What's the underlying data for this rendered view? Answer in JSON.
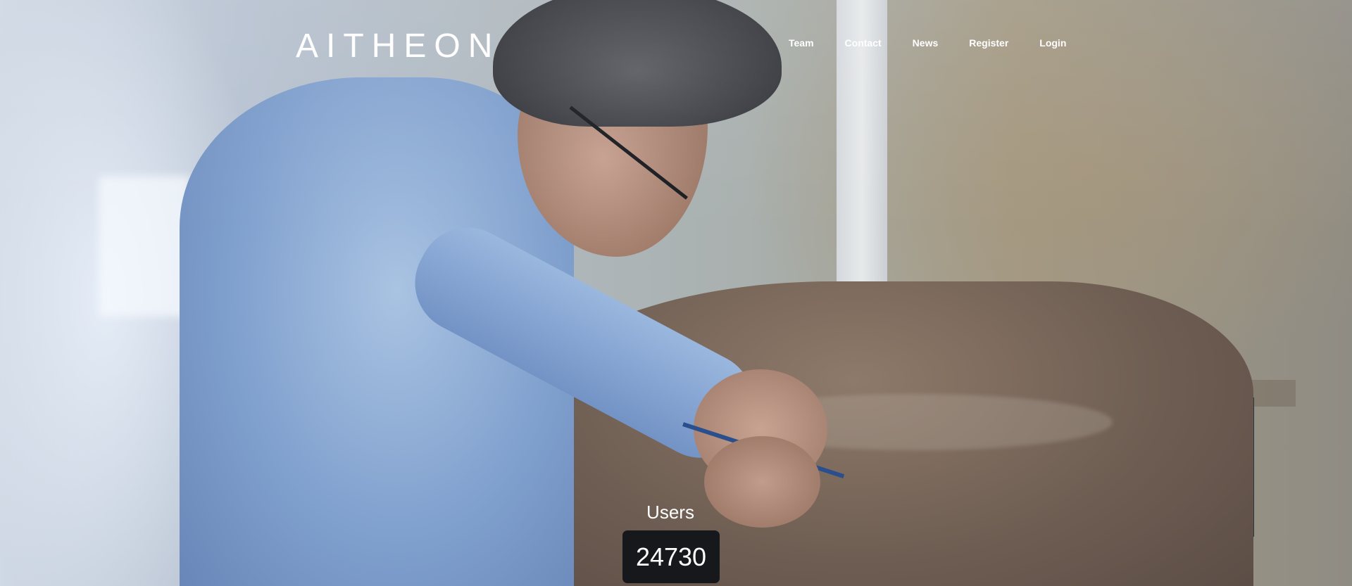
{
  "brand": {
    "logo_text": "AITHEON"
  },
  "nav": {
    "items": [
      {
        "label": "Team"
      },
      {
        "label": "Contact"
      },
      {
        "label": "News"
      },
      {
        "label": "Register"
      },
      {
        "label": "Login"
      }
    ]
  },
  "stats": {
    "label": "Users",
    "value": "24730"
  },
  "hero": {
    "image_description_icon": "hero-photo"
  },
  "colors": {
    "text": "#ffffff",
    "counter_bg": "#0f1218"
  }
}
